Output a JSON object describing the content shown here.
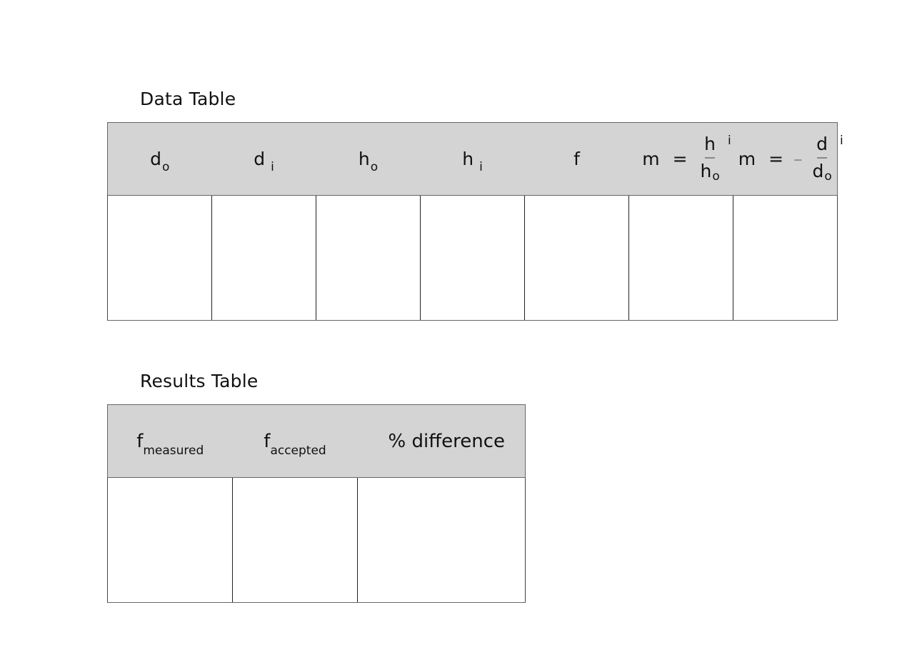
{
  "data_table": {
    "title": "Data Table",
    "columns": [
      {
        "symbol": "d",
        "subscript": "o"
      },
      {
        "symbol": "d",
        "subscript": "i"
      },
      {
        "symbol": "h",
        "subscript": "o"
      },
      {
        "symbol": "h",
        "subscript": "i"
      },
      {
        "symbol": "f",
        "subscript": ""
      },
      {
        "lhs": "m",
        "op": "=",
        "sign": "",
        "num": "h",
        "num_sub": "i",
        "den": "h",
        "den_sub": "o"
      },
      {
        "lhs": "m",
        "op": "=",
        "sign": "–",
        "num": "d",
        "num_sub": "i",
        "den": "d",
        "den_sub": "o"
      }
    ],
    "rows": [
      [
        "",
        "",
        "",
        "",
        "",
        "",
        ""
      ]
    ]
  },
  "results_table": {
    "title": "Results Table",
    "columns": [
      {
        "symbol": "f",
        "subscript": "measured"
      },
      {
        "symbol": "f",
        "subscript": "accepted"
      },
      {
        "symbol": "% difference",
        "subscript": ""
      }
    ],
    "rows": [
      [
        "",
        "",
        ""
      ]
    ]
  }
}
